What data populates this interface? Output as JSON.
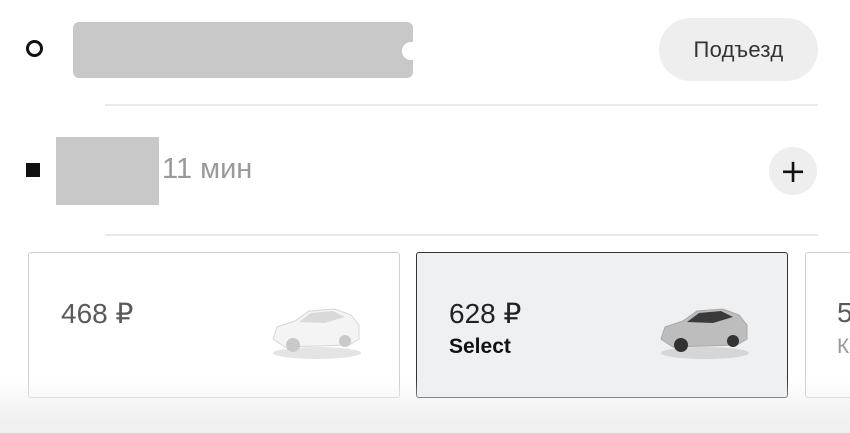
{
  "route": {
    "origin": {
      "address": "",
      "entrance_button": "Подъезд"
    },
    "destination": {
      "address": "",
      "eta": "11 мин",
      "add_stop_symbol": "+"
    }
  },
  "tariffs": [
    {
      "price": "468 ₽",
      "subtitle": "",
      "car_color": "#f2f2f2",
      "selected": false
    },
    {
      "price": "628 ₽",
      "subtitle": "Select",
      "car_color": "#bdbdbd",
      "selected": true
    },
    {
      "price": "5",
      "subtitle": "К",
      "car_color": "",
      "selected": false
    }
  ],
  "colors": {
    "redaction": "#c8c8c8",
    "selected_card_bg": "#eef0f1",
    "chip_bg": "#eeeeee"
  }
}
